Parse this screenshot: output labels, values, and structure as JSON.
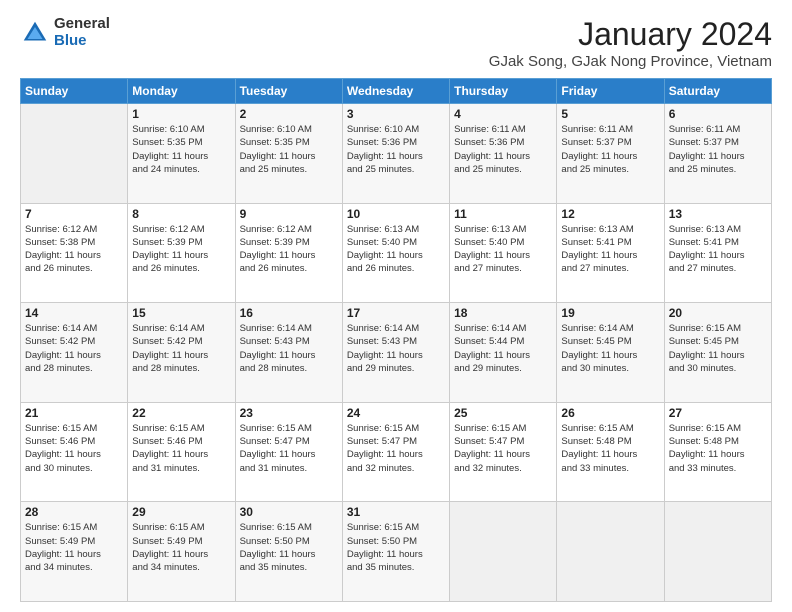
{
  "header": {
    "logo_general": "General",
    "logo_blue": "Blue",
    "month_title": "January 2024",
    "location": "GJak Song, GJak Nong Province, Vietnam"
  },
  "days_of_week": [
    "Sunday",
    "Monday",
    "Tuesday",
    "Wednesday",
    "Thursday",
    "Friday",
    "Saturday"
  ],
  "weeks": [
    [
      {
        "day": "",
        "info": ""
      },
      {
        "day": "1",
        "info": "Sunrise: 6:10 AM\nSunset: 5:35 PM\nDaylight: 11 hours\nand 24 minutes."
      },
      {
        "day": "2",
        "info": "Sunrise: 6:10 AM\nSunset: 5:35 PM\nDaylight: 11 hours\nand 25 minutes."
      },
      {
        "day": "3",
        "info": "Sunrise: 6:10 AM\nSunset: 5:36 PM\nDaylight: 11 hours\nand 25 minutes."
      },
      {
        "day": "4",
        "info": "Sunrise: 6:11 AM\nSunset: 5:36 PM\nDaylight: 11 hours\nand 25 minutes."
      },
      {
        "day": "5",
        "info": "Sunrise: 6:11 AM\nSunset: 5:37 PM\nDaylight: 11 hours\nand 25 minutes."
      },
      {
        "day": "6",
        "info": "Sunrise: 6:11 AM\nSunset: 5:37 PM\nDaylight: 11 hours\nand 25 minutes."
      }
    ],
    [
      {
        "day": "7",
        "info": "Sunrise: 6:12 AM\nSunset: 5:38 PM\nDaylight: 11 hours\nand 26 minutes."
      },
      {
        "day": "8",
        "info": "Sunrise: 6:12 AM\nSunset: 5:39 PM\nDaylight: 11 hours\nand 26 minutes."
      },
      {
        "day": "9",
        "info": "Sunrise: 6:12 AM\nSunset: 5:39 PM\nDaylight: 11 hours\nand 26 minutes."
      },
      {
        "day": "10",
        "info": "Sunrise: 6:13 AM\nSunset: 5:40 PM\nDaylight: 11 hours\nand 26 minutes."
      },
      {
        "day": "11",
        "info": "Sunrise: 6:13 AM\nSunset: 5:40 PM\nDaylight: 11 hours\nand 27 minutes."
      },
      {
        "day": "12",
        "info": "Sunrise: 6:13 AM\nSunset: 5:41 PM\nDaylight: 11 hours\nand 27 minutes."
      },
      {
        "day": "13",
        "info": "Sunrise: 6:13 AM\nSunset: 5:41 PM\nDaylight: 11 hours\nand 27 minutes."
      }
    ],
    [
      {
        "day": "14",
        "info": "Sunrise: 6:14 AM\nSunset: 5:42 PM\nDaylight: 11 hours\nand 28 minutes."
      },
      {
        "day": "15",
        "info": "Sunrise: 6:14 AM\nSunset: 5:42 PM\nDaylight: 11 hours\nand 28 minutes."
      },
      {
        "day": "16",
        "info": "Sunrise: 6:14 AM\nSunset: 5:43 PM\nDaylight: 11 hours\nand 28 minutes."
      },
      {
        "day": "17",
        "info": "Sunrise: 6:14 AM\nSunset: 5:43 PM\nDaylight: 11 hours\nand 29 minutes."
      },
      {
        "day": "18",
        "info": "Sunrise: 6:14 AM\nSunset: 5:44 PM\nDaylight: 11 hours\nand 29 minutes."
      },
      {
        "day": "19",
        "info": "Sunrise: 6:14 AM\nSunset: 5:45 PM\nDaylight: 11 hours\nand 30 minutes."
      },
      {
        "day": "20",
        "info": "Sunrise: 6:15 AM\nSunset: 5:45 PM\nDaylight: 11 hours\nand 30 minutes."
      }
    ],
    [
      {
        "day": "21",
        "info": "Sunrise: 6:15 AM\nSunset: 5:46 PM\nDaylight: 11 hours\nand 30 minutes."
      },
      {
        "day": "22",
        "info": "Sunrise: 6:15 AM\nSunset: 5:46 PM\nDaylight: 11 hours\nand 31 minutes."
      },
      {
        "day": "23",
        "info": "Sunrise: 6:15 AM\nSunset: 5:47 PM\nDaylight: 11 hours\nand 31 minutes."
      },
      {
        "day": "24",
        "info": "Sunrise: 6:15 AM\nSunset: 5:47 PM\nDaylight: 11 hours\nand 32 minutes."
      },
      {
        "day": "25",
        "info": "Sunrise: 6:15 AM\nSunset: 5:47 PM\nDaylight: 11 hours\nand 32 minutes."
      },
      {
        "day": "26",
        "info": "Sunrise: 6:15 AM\nSunset: 5:48 PM\nDaylight: 11 hours\nand 33 minutes."
      },
      {
        "day": "27",
        "info": "Sunrise: 6:15 AM\nSunset: 5:48 PM\nDaylight: 11 hours\nand 33 minutes."
      }
    ],
    [
      {
        "day": "28",
        "info": "Sunrise: 6:15 AM\nSunset: 5:49 PM\nDaylight: 11 hours\nand 34 minutes."
      },
      {
        "day": "29",
        "info": "Sunrise: 6:15 AM\nSunset: 5:49 PM\nDaylight: 11 hours\nand 34 minutes."
      },
      {
        "day": "30",
        "info": "Sunrise: 6:15 AM\nSunset: 5:50 PM\nDaylight: 11 hours\nand 35 minutes."
      },
      {
        "day": "31",
        "info": "Sunrise: 6:15 AM\nSunset: 5:50 PM\nDaylight: 11 hours\nand 35 minutes."
      },
      {
        "day": "",
        "info": ""
      },
      {
        "day": "",
        "info": ""
      },
      {
        "day": "",
        "info": ""
      }
    ]
  ]
}
